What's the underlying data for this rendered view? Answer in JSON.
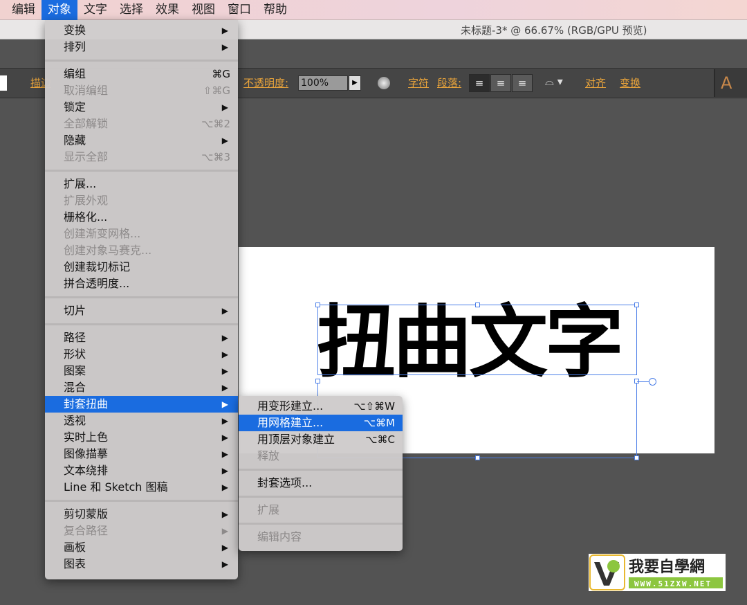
{
  "menubar": [
    "编辑",
    "对象",
    "文字",
    "选择",
    "效果",
    "视图",
    "窗口",
    "帮助"
  ],
  "active_menu": "对象",
  "title": "未标题-3* @ 66.67% (RGB/GPU 预览)",
  "control": {
    "stroke_label": "描边",
    "opacity_label": "不透明度:",
    "opacity_value": "100%",
    "char_label": "字符",
    "para_label": "段落:",
    "align_label": "对齐",
    "transform_label": "变换",
    "panel_letter": "A"
  },
  "canvas_text": "扭曲文字",
  "object_menu": [
    {
      "label": "变换",
      "arrow": true
    },
    {
      "label": "排列",
      "arrow": true
    },
    {
      "sep": true
    },
    {
      "label": "编组",
      "shortcut": "⌘G"
    },
    {
      "label": "取消编组",
      "shortcut": "⇧⌘G",
      "disabled": true
    },
    {
      "label": "锁定",
      "arrow": true
    },
    {
      "label": "全部解锁",
      "shortcut": "⌥⌘2",
      "disabled": true
    },
    {
      "label": "隐藏",
      "arrow": true
    },
    {
      "label": "显示全部",
      "shortcut": "⌥⌘3",
      "disabled": true
    },
    {
      "sep": true
    },
    {
      "label": "扩展..."
    },
    {
      "label": "扩展外观",
      "disabled": true
    },
    {
      "label": "栅格化..."
    },
    {
      "label": "创建渐变网格...",
      "disabled": true
    },
    {
      "label": "创建对象马赛克...",
      "disabled": true
    },
    {
      "label": "创建裁切标记"
    },
    {
      "label": "拼合透明度..."
    },
    {
      "sep": true
    },
    {
      "label": "切片",
      "arrow": true
    },
    {
      "sep": true
    },
    {
      "label": "路径",
      "arrow": true
    },
    {
      "label": "形状",
      "arrow": true
    },
    {
      "label": "图案",
      "arrow": true
    },
    {
      "label": "混合",
      "arrow": true
    },
    {
      "label": "封套扭曲",
      "arrow": true,
      "highlighted": true
    },
    {
      "label": "透视",
      "arrow": true
    },
    {
      "label": "实时上色",
      "arrow": true
    },
    {
      "label": "图像描摹",
      "arrow": true
    },
    {
      "label": "文本绕排",
      "arrow": true
    },
    {
      "label": "Line 和 Sketch 图稿",
      "arrow": true
    },
    {
      "sep": true
    },
    {
      "label": "剪切蒙版",
      "arrow": true
    },
    {
      "label": "复合路径",
      "arrow": true,
      "disabled": true
    },
    {
      "label": "画板",
      "arrow": true
    },
    {
      "label": "图表",
      "arrow": true
    }
  ],
  "envelope_submenu": [
    {
      "label": "用变形建立...",
      "shortcut": "⌥⇧⌘W"
    },
    {
      "label": "用网格建立...",
      "shortcut": "⌥⌘M",
      "highlighted": true
    },
    {
      "label": "用顶层对象建立",
      "shortcut": "⌥⌘C"
    },
    {
      "label": "释放",
      "disabled": true
    },
    {
      "sep": true
    },
    {
      "label": "封套选项..."
    },
    {
      "sep": true
    },
    {
      "label": "扩展",
      "disabled": true
    },
    {
      "sep": true
    },
    {
      "label": "编辑内容",
      "disabled": true
    }
  ],
  "watermark": {
    "name": "我要自學網",
    "url": "WWW.51ZXW.NET"
  },
  "colors": {
    "accent": "#1a6ce0",
    "selection": "#4a7ee8",
    "label_orange": "#e8a33b"
  }
}
